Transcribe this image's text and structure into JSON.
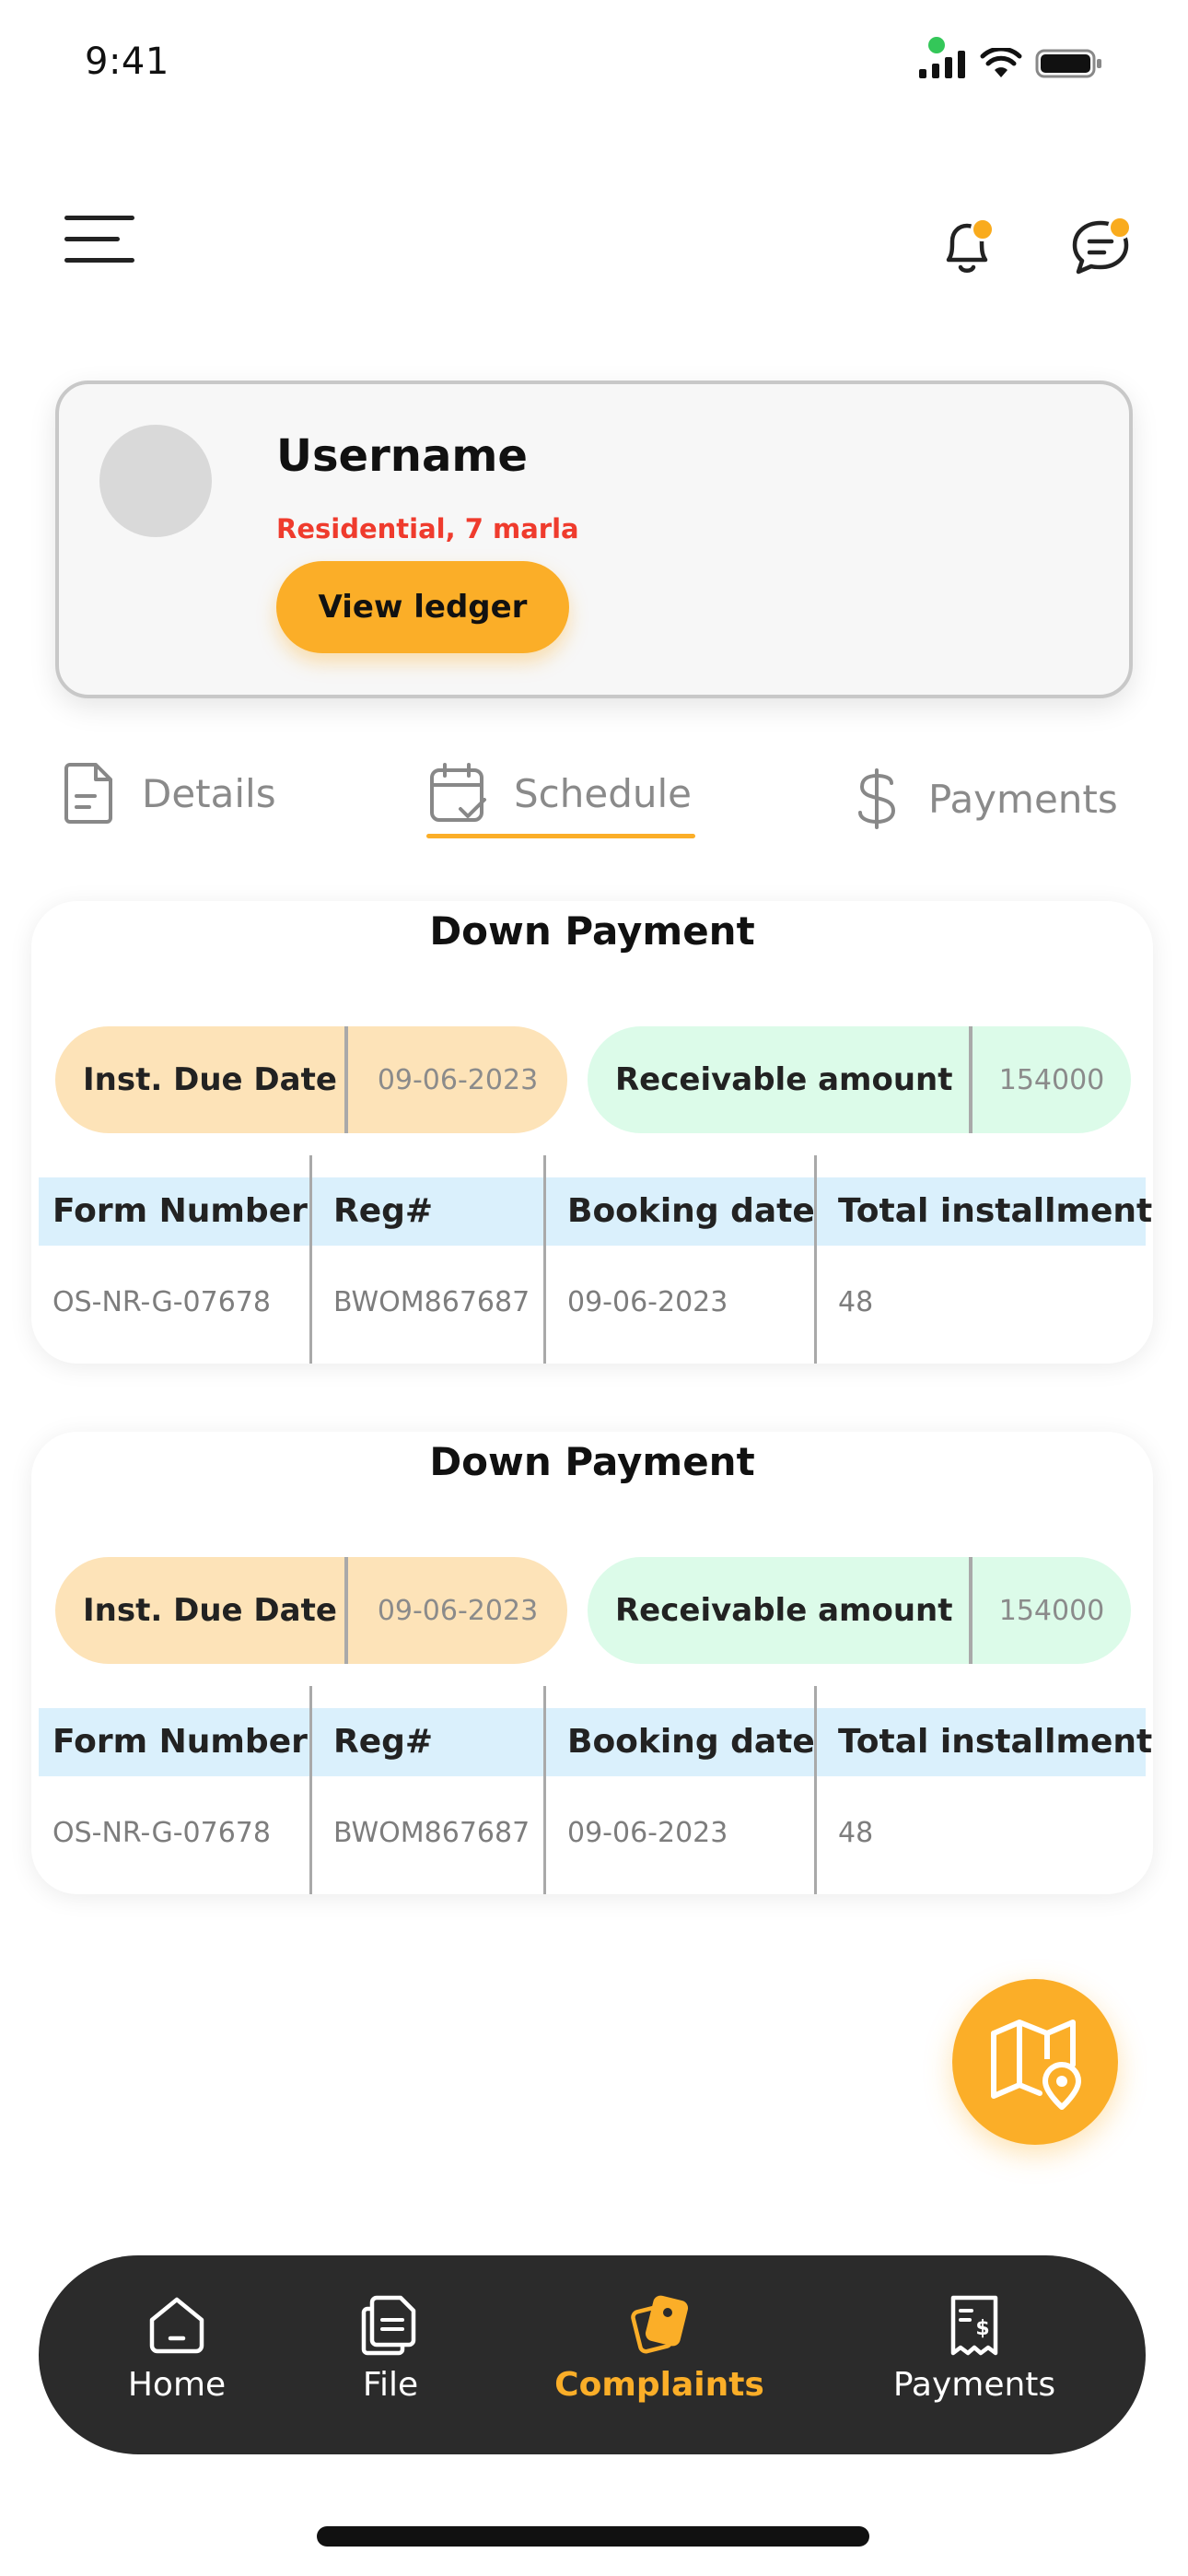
{
  "status_bar": {
    "time": "9:41"
  },
  "profile": {
    "username": "Username",
    "property": "Residential, 7 marla",
    "ledger_button": "View ledger"
  },
  "tabs": [
    {
      "label": "Details",
      "icon": "document-icon",
      "active": false
    },
    {
      "label": "Schedule",
      "icon": "calendar-check-icon",
      "active": true
    },
    {
      "label": "Payments",
      "icon": "dollar-icon",
      "active": false
    }
  ],
  "schedule": [
    {
      "title": "Down Payment",
      "due_label": "Inst. Due Date",
      "due_value": "09-06-2023",
      "receivable_label": "Receivable amount",
      "receivable_value": "154000",
      "columns": [
        "Form Number",
        "Reg#",
        "Booking date",
        "Total installment"
      ],
      "row": [
        "OS-NR-G-07678",
        "BWOM867687",
        "09-06-2023",
        "48"
      ]
    },
    {
      "title": "Down Payment",
      "due_label": "Inst. Due Date",
      "due_value": "09-06-2023",
      "receivable_label": "Receivable amount",
      "receivable_value": "154000",
      "columns": [
        "Form Number",
        "Reg#",
        "Booking date",
        "Total installment"
      ],
      "row": [
        "OS-NR-G-07678",
        "BWOM867687",
        "09-06-2023",
        "48"
      ]
    }
  ],
  "bottom_nav": [
    {
      "label": "Home",
      "icon": "home-icon",
      "active": false
    },
    {
      "label": "File",
      "icon": "files-icon",
      "active": false
    },
    {
      "label": "Complaints",
      "icon": "tags-icon",
      "active": true
    },
    {
      "label": "Payments",
      "icon": "receipt-icon",
      "active": false
    }
  ],
  "colors": {
    "accent": "#fbae28",
    "alert_red": "#ef3b2d",
    "due_pill": "#fde3b8",
    "receivable_pill": "#dcfbe9",
    "table_header": "#daf0fc",
    "nav_bg": "#2b2b2b"
  }
}
